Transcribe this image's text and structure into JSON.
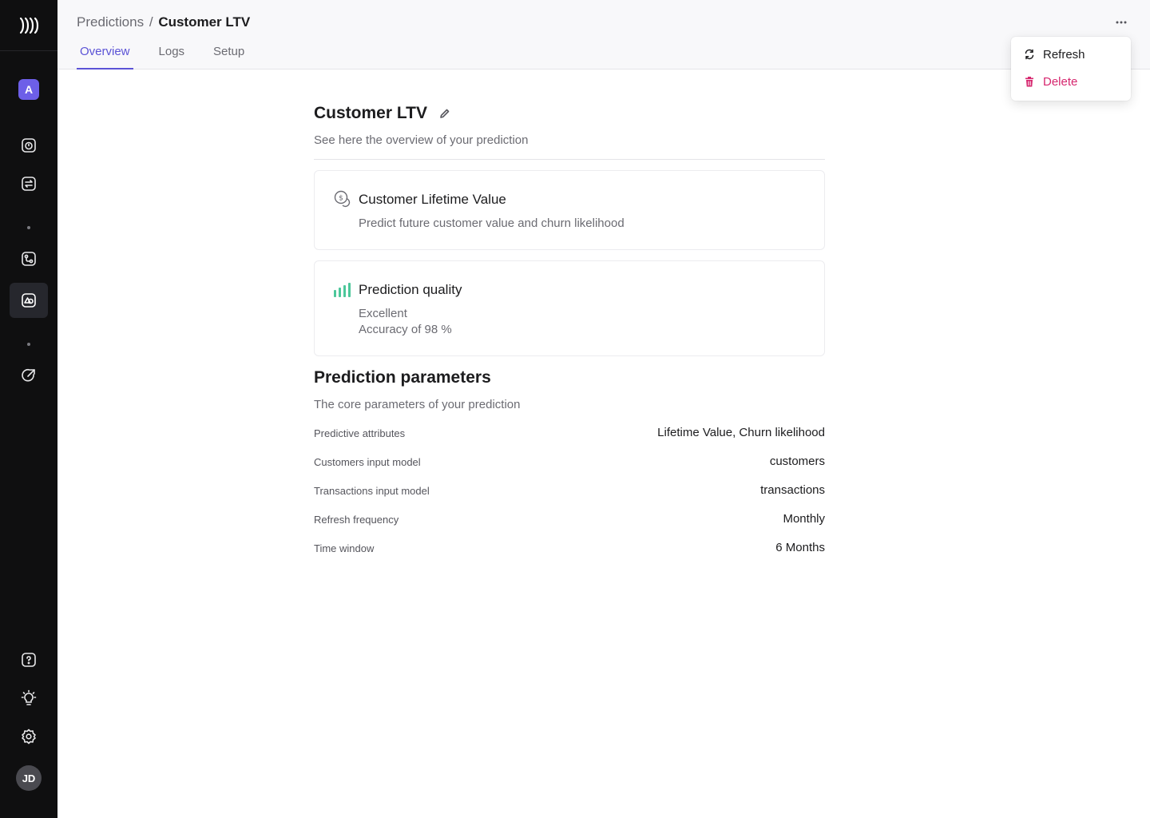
{
  "sidebar": {
    "workspace_initial": "A",
    "user_initials": "JD",
    "icons": [
      "logo-icon",
      "workspace-badge",
      "stopwatch-icon",
      "transfer-icon",
      "flow-icon",
      "predictions-icon",
      "growth-icon",
      "help-icon",
      "lightbulb-icon",
      "settings-icon",
      "avatar"
    ]
  },
  "header": {
    "breadcrumb_parent": "Predictions",
    "breadcrumb_separator": "/",
    "breadcrumb_current": "Customer LTV",
    "tabs": [
      {
        "label": "Overview",
        "active": true
      },
      {
        "label": "Logs",
        "active": false
      },
      {
        "label": "Setup",
        "active": false
      }
    ]
  },
  "menu": {
    "refresh_label": "Refresh",
    "delete_label": "Delete"
  },
  "main": {
    "title": "Customer LTV",
    "subtitle": "See here the overview of your prediction",
    "card_ltv": {
      "title": "Customer Lifetime Value",
      "description": "Predict future customer value and churn likelihood"
    },
    "card_quality": {
      "title": "Prediction quality",
      "rating": "Excellent",
      "accuracy": "Accuracy of 98 %"
    },
    "params_title": "Prediction parameters",
    "params_subtitle": "The core parameters of your prediction",
    "params": [
      {
        "label": "Predictive attributes",
        "value": "Lifetime Value, Churn likelihood"
      },
      {
        "label": "Customers input model",
        "value": "customers"
      },
      {
        "label": "Transactions input model",
        "value": "transactions"
      },
      {
        "label": "Refresh frequency",
        "value": "Monthly"
      },
      {
        "label": "Time window",
        "value": "6 Months"
      }
    ]
  },
  "colors": {
    "accent": "#5b53d6",
    "danger": "#d6266e",
    "quality": "#4cc79a",
    "sidebar_bg": "#0f0f10"
  }
}
